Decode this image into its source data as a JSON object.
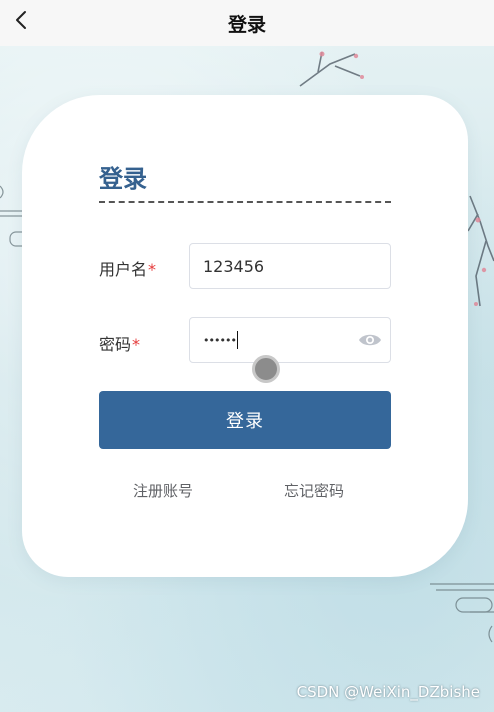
{
  "nav": {
    "title": "登录",
    "back_icon": "chevron-left-icon"
  },
  "login_card": {
    "heading": "登录",
    "username": {
      "label": "用户名",
      "required_mark": "*",
      "value": "123456"
    },
    "password": {
      "label": "密码",
      "required_mark": "*",
      "value_masked": "••••••",
      "toggle_icon": "eye-icon"
    },
    "submit_label": "登录",
    "register_link": "注册账号",
    "forgot_link": "忘记密码"
  },
  "watermark": "CSDN @WeiXin_DZbishe",
  "colors": {
    "primary": "#35679a",
    "heading": "#35618f",
    "required": "#e53a3a",
    "card": "#ffffff",
    "background": "#dcecef"
  }
}
